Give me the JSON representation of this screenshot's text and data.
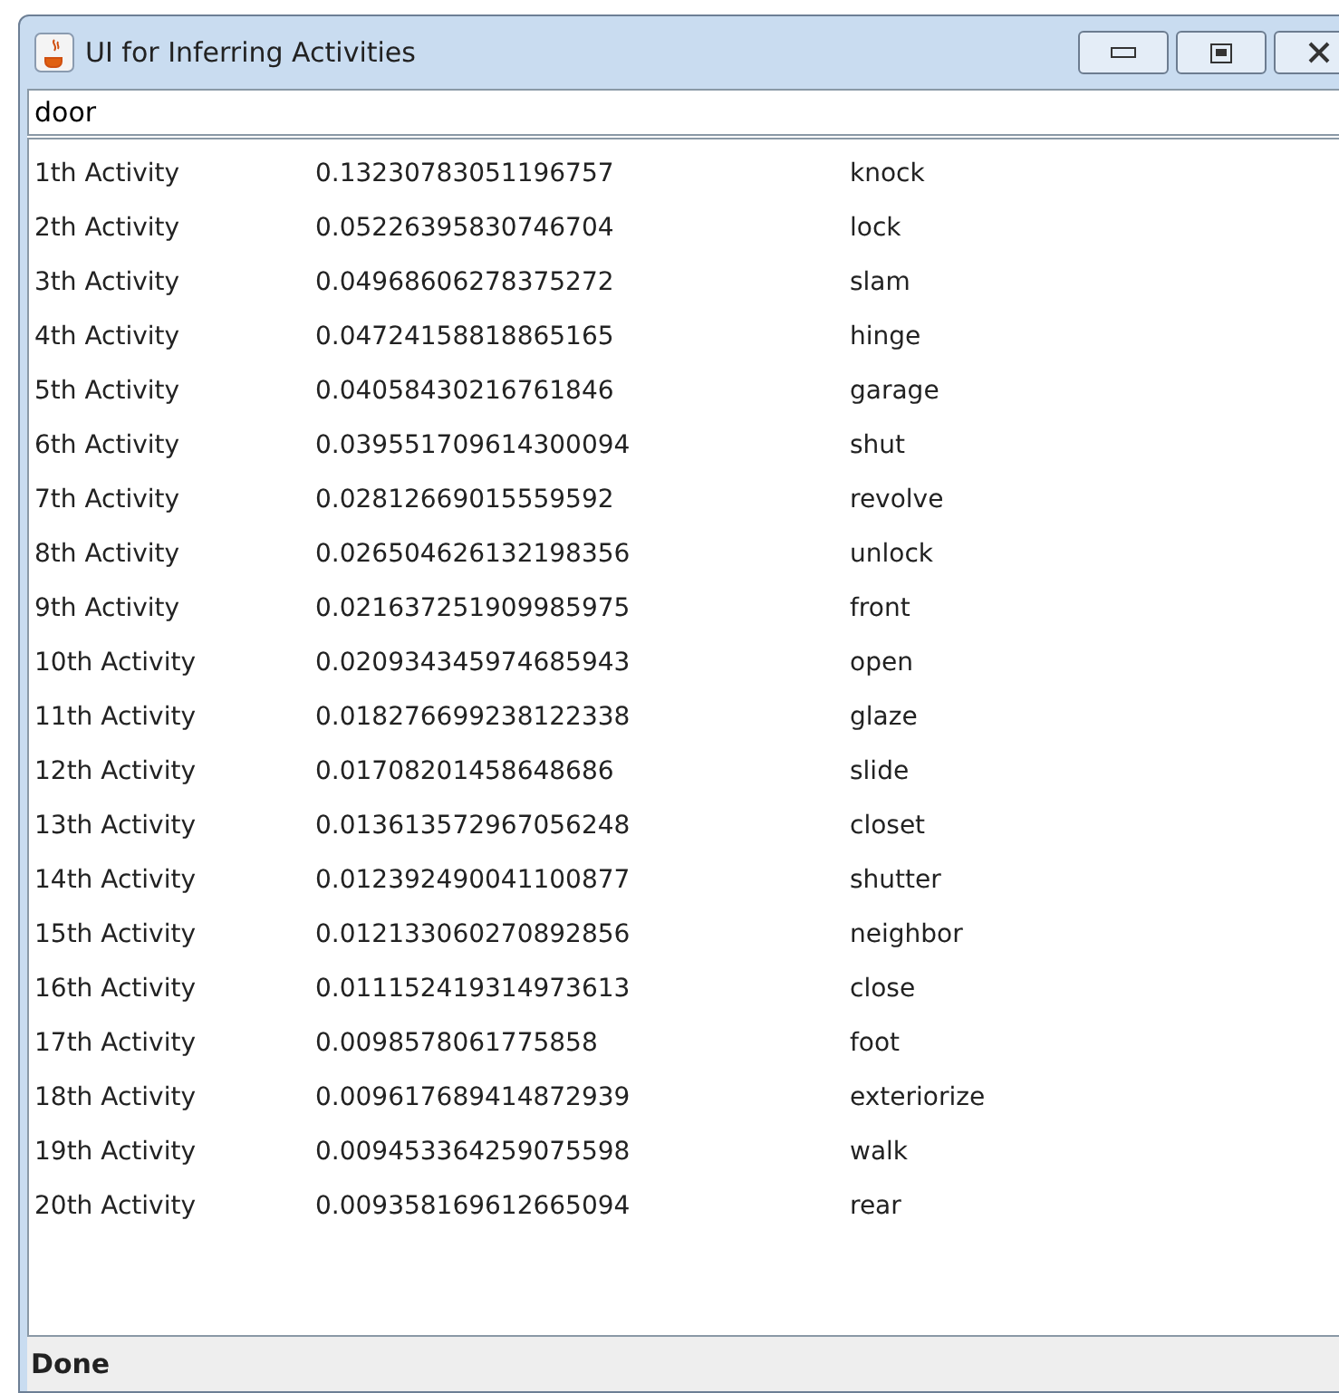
{
  "window": {
    "title": "UI for Inferring Activities"
  },
  "query": {
    "value": "door"
  },
  "results": [
    {
      "rank": "1th Activity",
      "score": "0.13230783051196757",
      "word": "knock"
    },
    {
      "rank": "2th Activity",
      "score": "0.05226395830746704",
      "word": "lock"
    },
    {
      "rank": "3th Activity",
      "score": "0.04968606278375272",
      "word": "slam"
    },
    {
      "rank": "4th Activity",
      "score": "0.04724158818865165",
      "word": "hinge"
    },
    {
      "rank": "5th Activity",
      "score": "0.04058430216761846",
      "word": "garage"
    },
    {
      "rank": "6th Activity",
      "score": "0.039551709614300094",
      "word": "shut"
    },
    {
      "rank": "7th Activity",
      "score": "0.02812669015559592",
      "word": "revolve"
    },
    {
      "rank": "8th Activity",
      "score": "0.026504626132198356",
      "word": "unlock"
    },
    {
      "rank": "9th Activity",
      "score": "0.021637251909985975",
      "word": "front"
    },
    {
      "rank": "10th Activity",
      "score": "0.020934345974685943",
      "word": "open"
    },
    {
      "rank": "11th Activity",
      "score": "0.018276699238122338",
      "word": "glaze"
    },
    {
      "rank": "12th Activity",
      "score": "0.01708201458648686",
      "word": "slide"
    },
    {
      "rank": "13th Activity",
      "score": "0.013613572967056248",
      "word": "closet"
    },
    {
      "rank": "14th Activity",
      "score": "0.012392490041100877",
      "word": "shutter"
    },
    {
      "rank": "15th Activity",
      "score": "0.012133060270892856",
      "word": "neighbor"
    },
    {
      "rank": "16th Activity",
      "score": "0.011152419314973613",
      "word": "close"
    },
    {
      "rank": "17th Activity",
      "score": "0.0098578061775858",
      "word": "foot"
    },
    {
      "rank": "18th Activity",
      "score": "0.009617689414872939",
      "word": "exteriorize"
    },
    {
      "rank": "19th Activity",
      "score": "0.009453364259075598",
      "word": "walk"
    },
    {
      "rank": "20th Activity",
      "score": "0.009358169612665094",
      "word": "rear"
    }
  ],
  "status_bar": "Done"
}
